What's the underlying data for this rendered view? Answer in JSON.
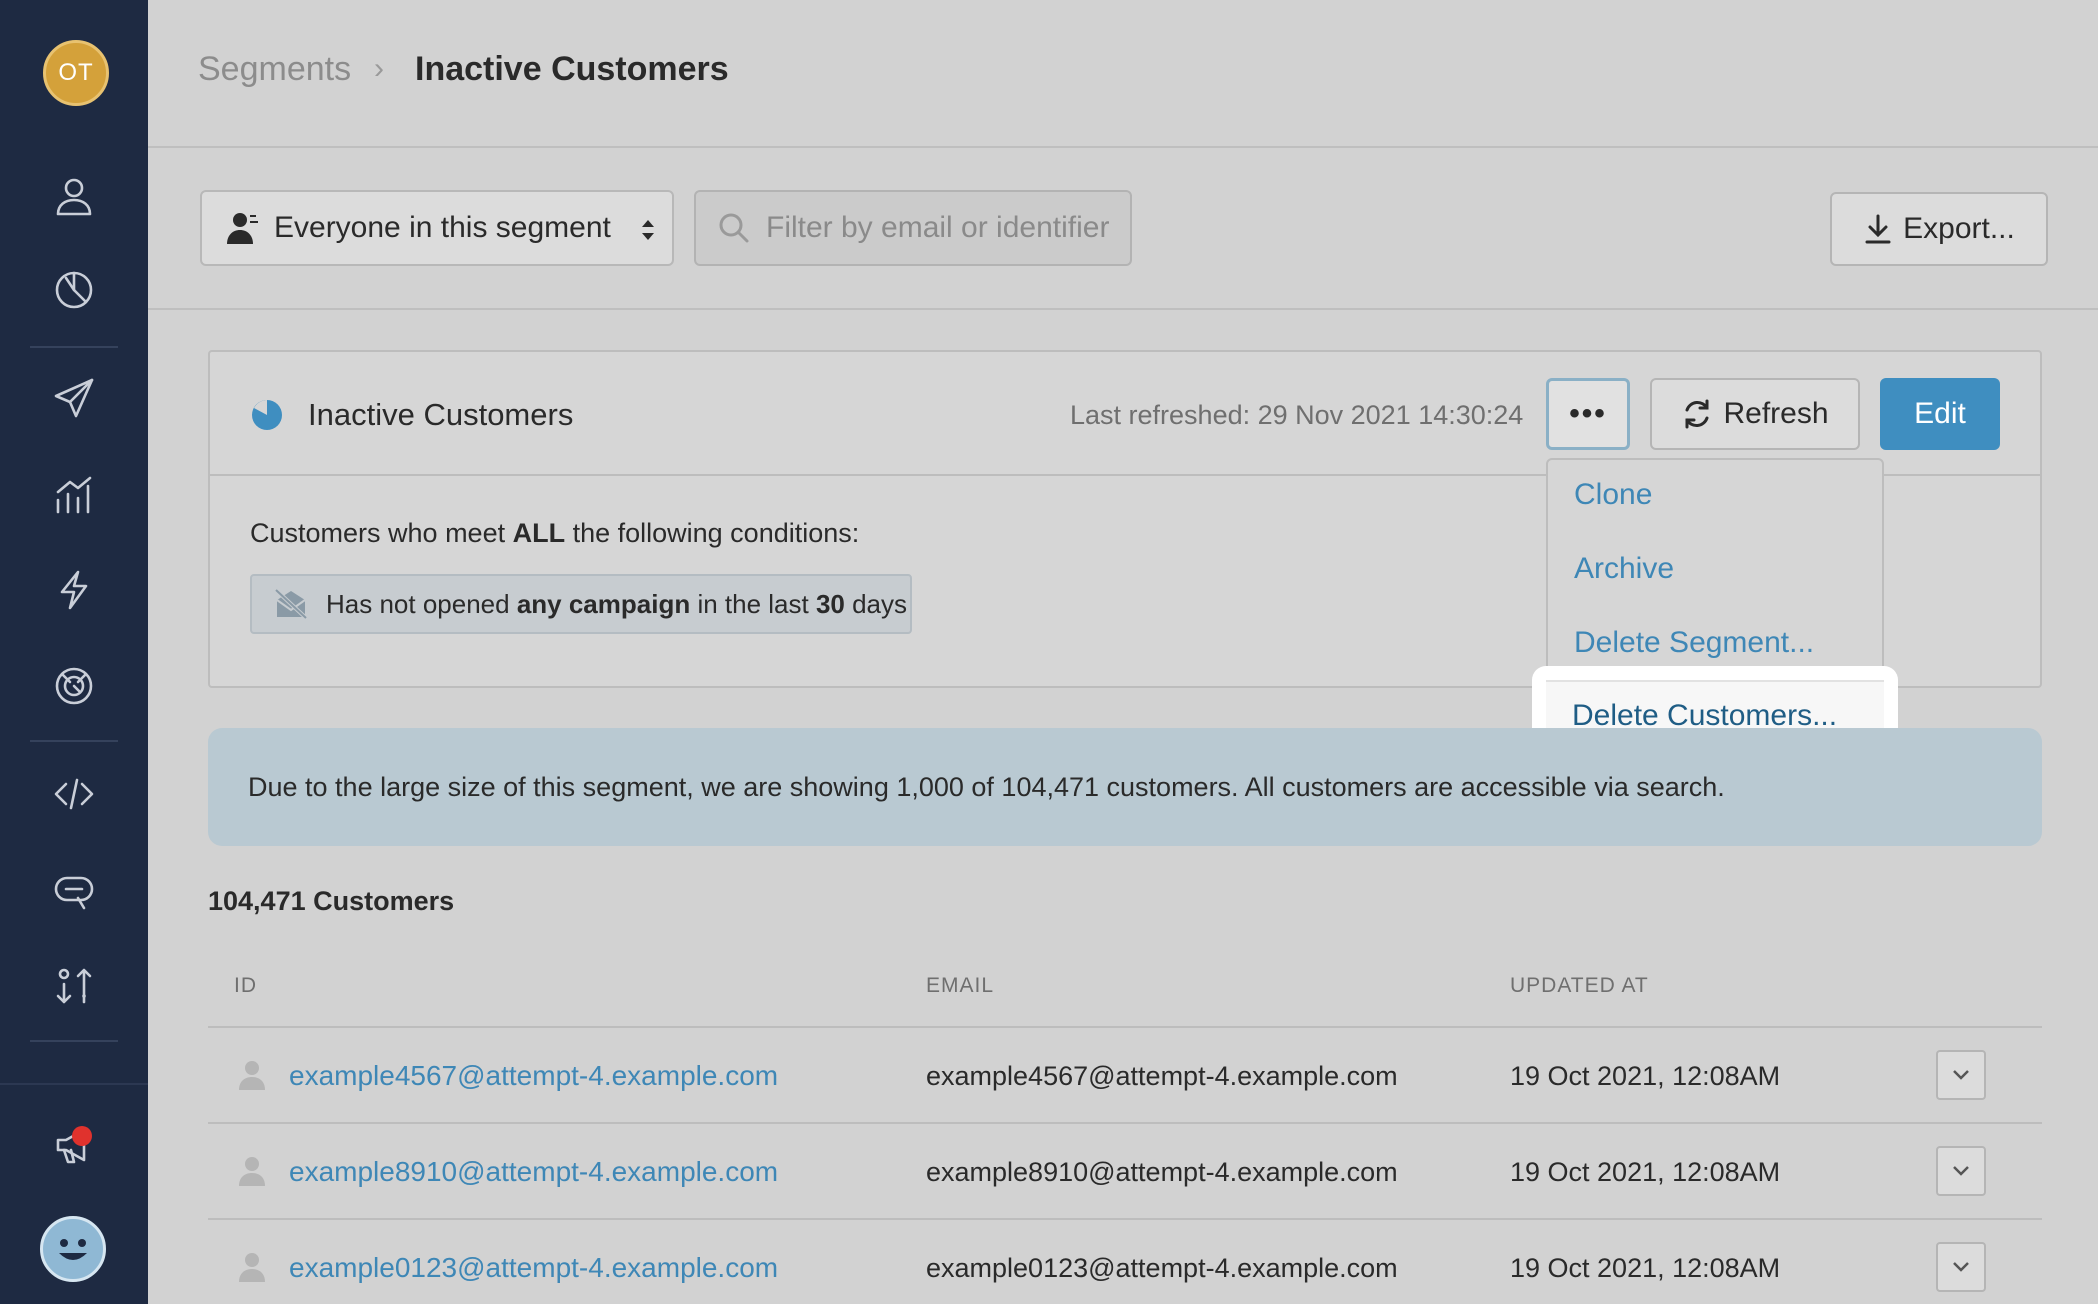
{
  "sidebar": {
    "account_initials": "OT",
    "items": [
      {
        "name": "people"
      },
      {
        "name": "segments"
      },
      {
        "name": "campaigns"
      },
      {
        "name": "analytics"
      },
      {
        "name": "actions"
      },
      {
        "name": "integrations"
      },
      {
        "name": "developer"
      },
      {
        "name": "messages"
      },
      {
        "name": "data-sync"
      }
    ]
  },
  "breadcrumb": {
    "root": "Segments",
    "separator": "›",
    "current": "Inactive Customers"
  },
  "toolbar": {
    "segment_select": "Everyone in this segment",
    "filter_placeholder": "Filter by email or identifier",
    "export_label": "Export..."
  },
  "segment_card": {
    "title": "Inactive Customers",
    "last_refreshed": "Last refreshed: 29 Nov 2021 14:30:24",
    "more_label": "•••",
    "refresh_label": "Refresh",
    "edit_label": "Edit",
    "condition_prefix": "Customers who meet ",
    "condition_bold": "ALL",
    "condition_suffix": " the following conditions:",
    "condition_chip": {
      "part1": "Has not opened ",
      "bold1": "any campaign",
      "part2": " in the last ",
      "bold2": "30",
      "part3": " days"
    }
  },
  "dropdown": {
    "items": [
      "Clone",
      "Archive",
      "Delete Segment...",
      "Delete Customers..."
    ]
  },
  "notice": "Due to the large size of this segment, we are showing 1,000 of 104,471 customers. All customers are accessible via search.",
  "customers_count": "104,471 Customers",
  "table": {
    "headers": [
      "ID",
      "EMAIL",
      "UPDATED AT"
    ],
    "rows": [
      {
        "id": "example4567@attempt-4.example.com",
        "email": "example4567@attempt-4.example.com",
        "updated": "19 Oct 2021, 12:08AM"
      },
      {
        "id": "example8910@attempt-4.example.com",
        "email": "example8910@attempt-4.example.com",
        "updated": "19 Oct 2021, 12:08AM"
      },
      {
        "id": "example0123@attempt-4.example.com",
        "email": "example0123@attempt-4.example.com",
        "updated": "19 Oct 2021, 12:08AM"
      }
    ]
  },
  "colors": {
    "sidebar_bg": "#1e2a42",
    "accent": "#3f8ec0",
    "link": "#3e87b6",
    "notification": "#e0322d"
  }
}
